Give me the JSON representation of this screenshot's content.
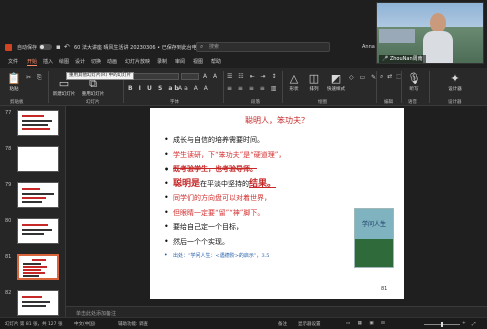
{
  "titlebar": {
    "autosave_label": "自动保存",
    "autosave_state": "关",
    "file_name": "60 法大讲座 晴风生活讲 20230306 • 已保存到此台电脑",
    "search_placeholder": "搜索",
    "user": "Anna"
  },
  "tabs": [
    "文件",
    "开始",
    "插入",
    "绘图",
    "设计",
    "切换",
    "动画",
    "幻灯片放映",
    "录制",
    "审阅",
    "视图",
    "帮助"
  ],
  "active_tab": "开始",
  "ribbon": {
    "groups": [
      "剪贴板",
      "幻灯片",
      "字体",
      "段落",
      "绘图",
      "编辑",
      "语音",
      "设计器"
    ],
    "buttons": {
      "paste": "粘贴",
      "new_slide": "新建幻灯片",
      "reuse_slides": "重用幻灯片",
      "shapes": "形状",
      "arrange": "排列",
      "quick_styles": "快速样式",
      "dictate": "听写",
      "designer": "设计器"
    },
    "tooltip": "重用其他幻灯片(R) 中的幻灯片"
  },
  "thumbnails": [
    {
      "num": "77"
    },
    {
      "num": "78"
    },
    {
      "num": "79"
    },
    {
      "num": "80"
    },
    {
      "num": "81"
    },
    {
      "num": "82"
    }
  ],
  "slide": {
    "title": "聪明人，笨功夫？",
    "bullets": [
      {
        "text": "成长与自信的培养需要时间。",
        "style": "black"
      },
      {
        "text": "学生读研，下“笨功夫”是“硬道理”，",
        "style": "red"
      },
      {
        "text": "既考验学生，也考验导师。",
        "style": "strike"
      },
      {
        "pre": "聪明是",
        "text": "在平淡中坚持的",
        "post": "结果。",
        "style": "mixed"
      },
      {
        "text": "同学们的方向盘可以对着世界，",
        "style": "red"
      },
      {
        "text": "但眼睛一定要“留”“神”脚下。",
        "style": "red"
      },
      {
        "text": "要给自己定一个目标，",
        "style": "black"
      },
      {
        "text": "然后一个个实现。",
        "style": "black"
      },
      {
        "text": "出处：“学问人生：<遇德阶>的启示”，3.5",
        "style": "ref"
      }
    ],
    "book_title": "学问人生",
    "page_number": "81"
  },
  "notes_placeholder": "单击此处添加备注",
  "status": {
    "slide_pos": "幻灯片 第 81 张，共 127 张",
    "language": "中文(中国)",
    "accessibility": "辅助功能: 调查",
    "notes": "备注",
    "view": "显示器设置",
    "zoom": "+"
  },
  "video": {
    "participant": "ZhouNan周南"
  }
}
